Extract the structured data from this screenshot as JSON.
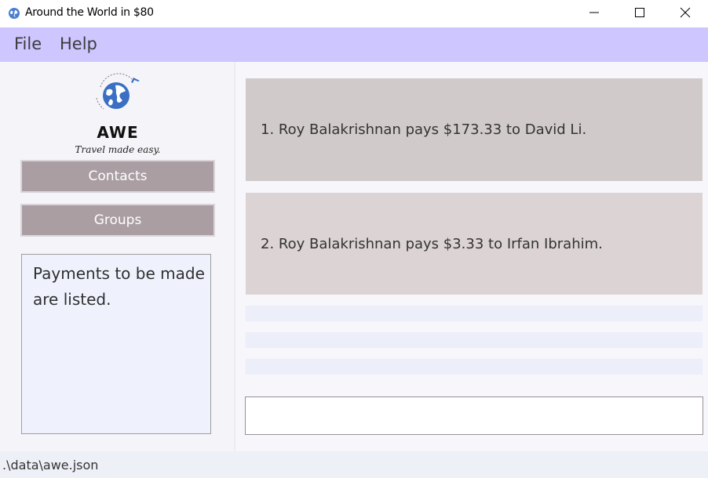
{
  "window": {
    "title": "Around the World in $80",
    "icon": "globe-icon",
    "controls": [
      "minimize-icon",
      "maximize-icon",
      "close-icon"
    ]
  },
  "menu": {
    "file": "File",
    "help": "Help"
  },
  "sidebar": {
    "logo": {
      "title": "AWE",
      "tagline": "Travel made easy."
    },
    "buttons": {
      "contacts": "Contacts",
      "groups": "Groups"
    },
    "info": "Payments to be made are listed."
  },
  "payments": [
    "1. Roy Balakrishnan pays $173.33 to David Li.",
    "2. Roy Balakrishnan pays $3.33 to Irfan Ibrahim."
  ],
  "command_input": {
    "value": ""
  },
  "status": {
    "file_path": ".\\data\\awe.json"
  },
  "colors": {
    "menubar": "#cec6ff",
    "nav_button": "#aa9ea3",
    "card_1": "#d0caca",
    "card_2": "#dcd4d4",
    "logo_blue": "#3a6fc4"
  }
}
